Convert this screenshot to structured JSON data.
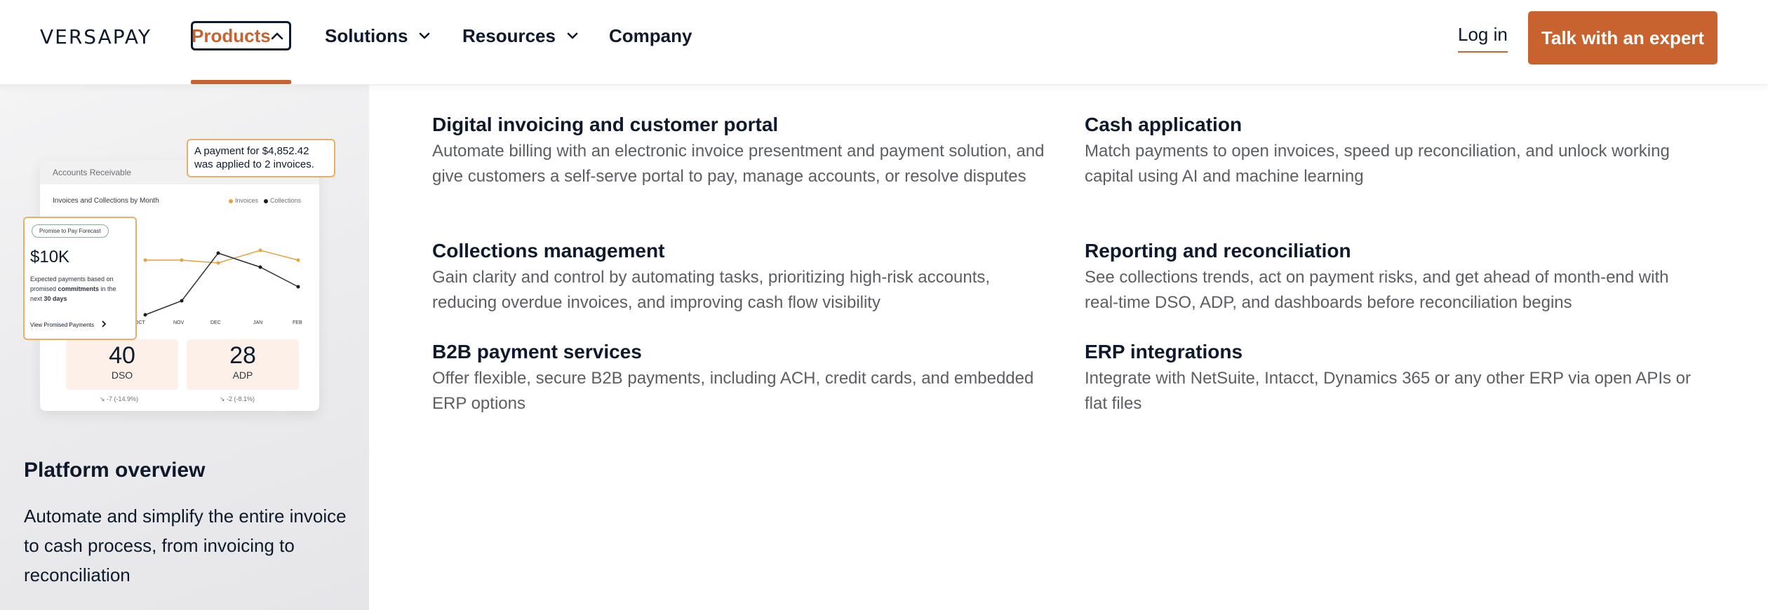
{
  "header": {
    "logo": "VERSAPAY",
    "nav": [
      {
        "label": "Products",
        "active": true
      },
      {
        "label": "Solutions"
      },
      {
        "label": "Resources"
      },
      {
        "label": "Company"
      }
    ],
    "login_label": "Log in",
    "cta_label": "Talk with an expert",
    "accent_color": "#c8632f"
  },
  "left_panel": {
    "card": {
      "header": "Accounts Receivable",
      "subtitle": "Invoices and Collections by Month",
      "legend": [
        "Invoices",
        "Collections"
      ],
      "months": [
        "OCT",
        "NOV",
        "DEC",
        "JAN",
        "FEB"
      ],
      "stats": [
        {
          "value": "40",
          "label": "DSO",
          "delta": "-7 (-14.9%)"
        },
        {
          "value": "28",
          "label": "ADP",
          "delta": "-2 (-8.1%)"
        }
      ],
      "popup": {
        "line1": "A payment for $4,852.42",
        "line2": "was applied to 2 invoices."
      },
      "forecast": {
        "pill": "Promise to Pay Forecast",
        "amount": "$10K",
        "desc_pre": "Expected payments based on promised ",
        "desc_bold1": "commitments",
        "desc_mid": " in the next ",
        "desc_bold2": "30 days",
        "link": "View Promised Payments"
      }
    },
    "title": "Platform overview",
    "description": "Automate and simplify the entire invoice to cash process, from invoicing to reconciliation"
  },
  "products": [
    {
      "title": "Digital invoicing and customer portal",
      "description": "Automate billing with an electronic invoice presentment and payment solution, and give customers a self-serve portal to pay, manage accounts, or resolve disputes"
    },
    {
      "title": "Cash application",
      "description": "Match payments to open invoices, speed up reconciliation, and unlock working capital using AI and machine learning"
    },
    {
      "title": "Collections management",
      "description": "Gain clarity and control by automating tasks, prioritizing high-risk accounts, reducing overdue invoices, and improving cash flow visibility"
    },
    {
      "title": "Reporting and reconciliation",
      "description": "See collections trends, act on payment risks, and get ahead of month-end with real-time DSO, ADP, and dashboards before reconciliation begins"
    },
    {
      "title": "B2B payment services",
      "description": "Offer flexible, secure B2B payments, including ACH, credit cards, and embedded ERP options"
    },
    {
      "title": "ERP integrations",
      "description": "Integrate with NetSuite, Intacct, Dynamics 365 or any other ERP via open APIs or flat files"
    }
  ]
}
